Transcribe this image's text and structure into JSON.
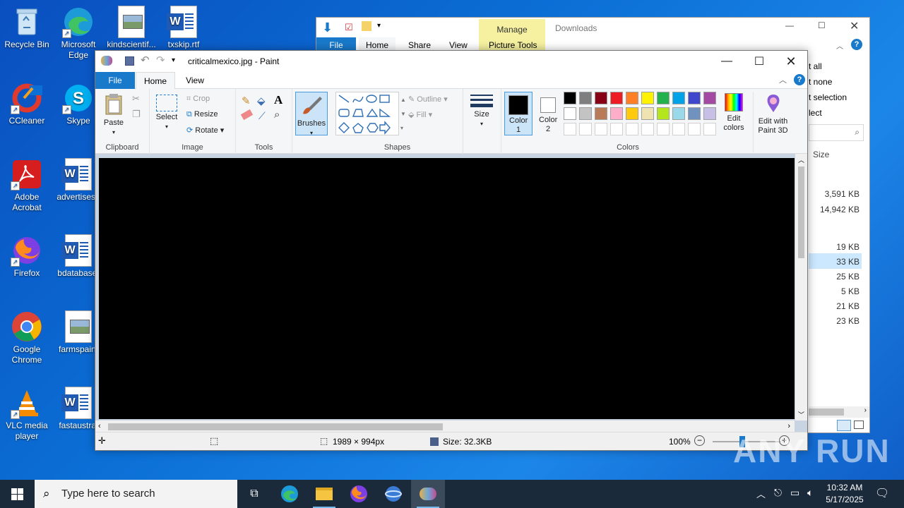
{
  "desktop": {
    "icons": [
      {
        "label": "Recycle Bin"
      },
      {
        "label": "Microsoft Edge"
      },
      {
        "label": "kindscientif..."
      },
      {
        "label": "txskip.rtf"
      },
      {
        "label": "CCleaner"
      },
      {
        "label": "Skype"
      },
      {
        "label": "Adobe Acrobat"
      },
      {
        "label": "advertisese"
      },
      {
        "label": "Firefox"
      },
      {
        "label": "bdatabase."
      },
      {
        "label": "Google Chrome"
      },
      {
        "label": "farmspain."
      },
      {
        "label": "VLC media player"
      },
      {
        "label": "fastaustral"
      }
    ]
  },
  "explorer": {
    "title": "Downloads",
    "manage": "Manage",
    "tabs": [
      "File",
      "Home",
      "Share",
      "View",
      "Picture Tools"
    ],
    "right_menu": [
      "t all",
      "t none",
      "t selection",
      "lect"
    ],
    "size_header": "Size",
    "sizes": [
      "3,591 KB",
      "14,942 KB",
      "19 KB",
      "33 KB",
      "25 KB",
      "5 KB",
      "21 KB",
      "23 KB"
    ]
  },
  "paint": {
    "title": "criticalmexico.jpg - Paint",
    "tabs": {
      "file": "File",
      "home": "Home",
      "view": "View"
    },
    "clipboard": {
      "paste": "Paste",
      "label": "Clipboard"
    },
    "image": {
      "select": "Select",
      "crop": "Crop",
      "resize": "Resize",
      "rotate": "Rotate",
      "label": "Image"
    },
    "tools": {
      "label": "Tools"
    },
    "brushes": "Brushes",
    "shapes": {
      "outline": "Outline",
      "fill": "Fill",
      "label": "Shapes"
    },
    "size": "Size",
    "color1": "Color 1",
    "color2": "Color 2",
    "colors_label": "Colors",
    "edit_colors": "Edit colors",
    "edit3d": "Edit with Paint 3D",
    "palette_row1": [
      "#000000",
      "#7f7f7f",
      "#880015",
      "#ed1c24",
      "#ff7f27",
      "#fff200",
      "#22b14c",
      "#00a2e8",
      "#3f48cc",
      "#a349a4"
    ],
    "palette_row2": [
      "#ffffff",
      "#c3c3c3",
      "#b97a57",
      "#ffaec9",
      "#ffc90e",
      "#efe4b0",
      "#b5e61d",
      "#99d9ea",
      "#7092be",
      "#c8bfe7"
    ],
    "status": {
      "dimensions": "1989 × 994px",
      "filesize": "Size: 32.3KB",
      "zoom": "100%"
    }
  },
  "taskbar": {
    "search_placeholder": "Type here to search",
    "time": "10:32 AM",
    "date": "5/17/2025"
  },
  "watermark": "ANY RUN"
}
